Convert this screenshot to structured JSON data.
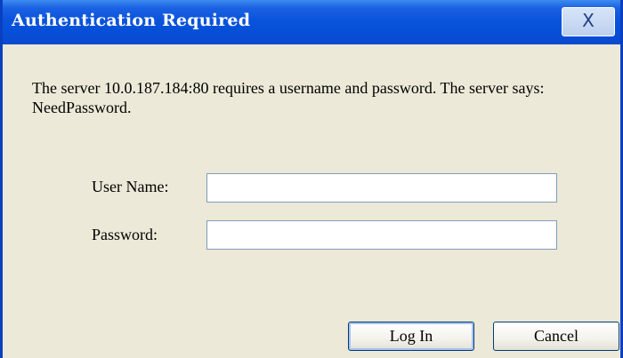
{
  "dialog": {
    "title": "Authentication Required",
    "close_glyph": "X",
    "message": "The server 10.0.187.184:80 requires a username and password. The server says: NeedPassword.",
    "fields": {
      "username_label": "User Name:",
      "username_value": "",
      "password_label": "Password:",
      "password_value": ""
    },
    "buttons": {
      "login_label": "Log In",
      "cancel_label": "Cancel"
    }
  },
  "colors": {
    "titlebar": "#0a53dc",
    "frame": "#0a3fbf",
    "body": "#ece9d8",
    "button_border": "#003c74",
    "input_border": "#7f9db9"
  },
  "icons": {
    "close": "close-icon"
  }
}
